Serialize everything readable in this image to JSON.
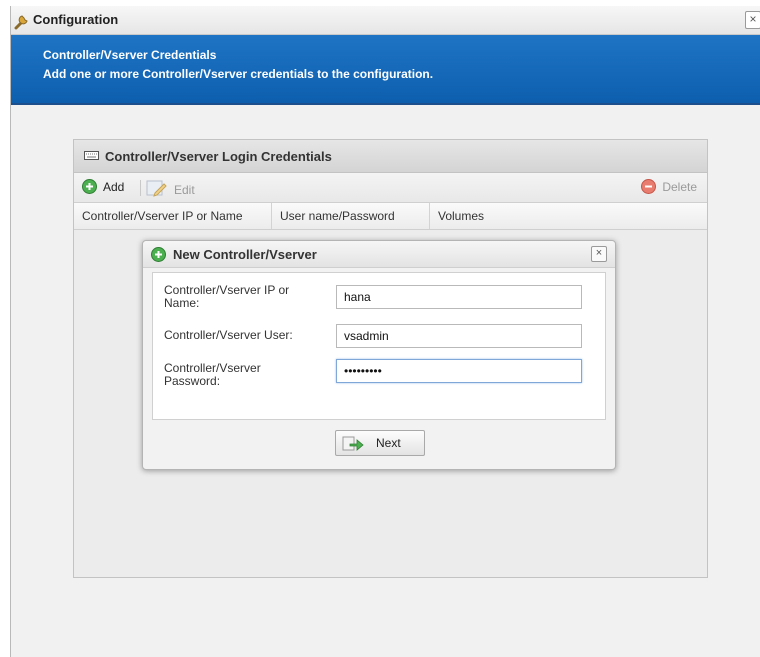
{
  "window": {
    "title": "Configuration",
    "close_label": "×"
  },
  "banner": {
    "heading": "Controller/Vserver Credentials",
    "description": "Add one or more Controller/Vserver credentials to the configuration."
  },
  "panel": {
    "title": "Controller/Vserver Login Credentials",
    "toolbar": {
      "add_label": "Add",
      "edit_label": "Edit",
      "delete_label": "Delete"
    },
    "columns": [
      "Controller/Vserver IP or Name",
      "User name/Password",
      "Volumes"
    ]
  },
  "dialog": {
    "title": "New Controller/Vserver",
    "close_label": "×",
    "fields": [
      {
        "label": "Controller/Vserver IP or Name:",
        "value": "hana"
      },
      {
        "label": "Controller/Vserver User:",
        "value": "vsadmin"
      },
      {
        "label": "Controller/Vserver Password:",
        "value": "•••••••••"
      }
    ],
    "next_label": "Next"
  },
  "colors": {
    "banner_blue": "#1069b8",
    "add_green": "#4caf50",
    "delete_red": "#e06a5c"
  }
}
